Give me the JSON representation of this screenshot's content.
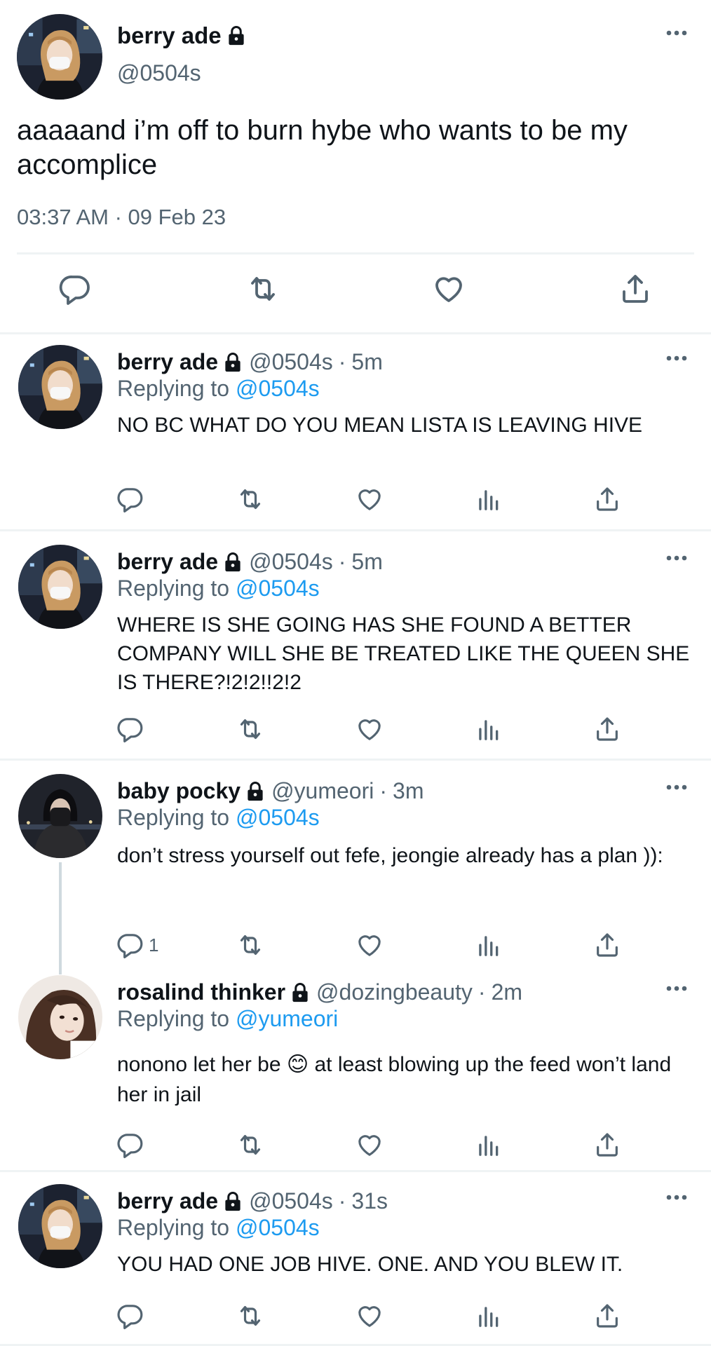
{
  "main_tweet": {
    "name": "berry ade",
    "handle": "@0504s",
    "text": "aaaaand i’m off to burn hybe who wants to be my accomplice",
    "timestamp": "03:37 AM · 09 Feb 23"
  },
  "replies": [
    {
      "name": "berry ade",
      "handle": "@0504s",
      "separator": "·",
      "time": "5m",
      "replying_prefix": "Replying to",
      "replying_to": "@0504s",
      "text": "NO BC WHAT DO YOU MEAN LISTA IS LEAVING HIVE",
      "reply_count": ""
    },
    {
      "name": "berry ade",
      "handle": "@0504s",
      "separator": "·",
      "time": "5m",
      "replying_prefix": "Replying to",
      "replying_to": "@0504s",
      "text": "WHERE IS SHE GOING HAS SHE FOUND A BETTER COMPANY WILL SHE BE TREATED LIKE THE QUEEN SHE IS THERE?!2!2!!2!2",
      "reply_count": ""
    },
    {
      "name": "baby pocky",
      "handle": "@yumeori",
      "separator": "·",
      "time": "3m",
      "replying_prefix": "Replying to",
      "replying_to": "@0504s",
      "text": "don’t stress yourself out fefe, jeongie already has a plan )):",
      "reply_count": "1"
    },
    {
      "name": "rosalind thinker",
      "handle": "@dozingbeauty",
      "separator": "·",
      "time": "2m",
      "replying_prefix": "Replying to",
      "replying_to": "@yumeori",
      "text": "nonono let her be 😊  at least blowing up the feed won’t land her in jail",
      "reply_count": ""
    },
    {
      "name": "berry ade",
      "handle": "@0504s",
      "separator": "·",
      "time": "31s",
      "replying_prefix": "Replying to",
      "replying_to": "@0504s",
      "text": "YOU HAD ONE JOB HIVE. ONE. AND YOU BLEW IT.",
      "reply_count": ""
    }
  ],
  "icons": {
    "lock": "lock-icon",
    "more": "more-icon",
    "reply": "reply-icon",
    "retweet": "retweet-icon",
    "like": "heart-icon",
    "views": "analytics-icon",
    "share": "share-icon"
  },
  "colors": {
    "text": "#0f1419",
    "secondary": "#536471",
    "accent": "#1d9bf0",
    "divider": "#eff3f4"
  }
}
